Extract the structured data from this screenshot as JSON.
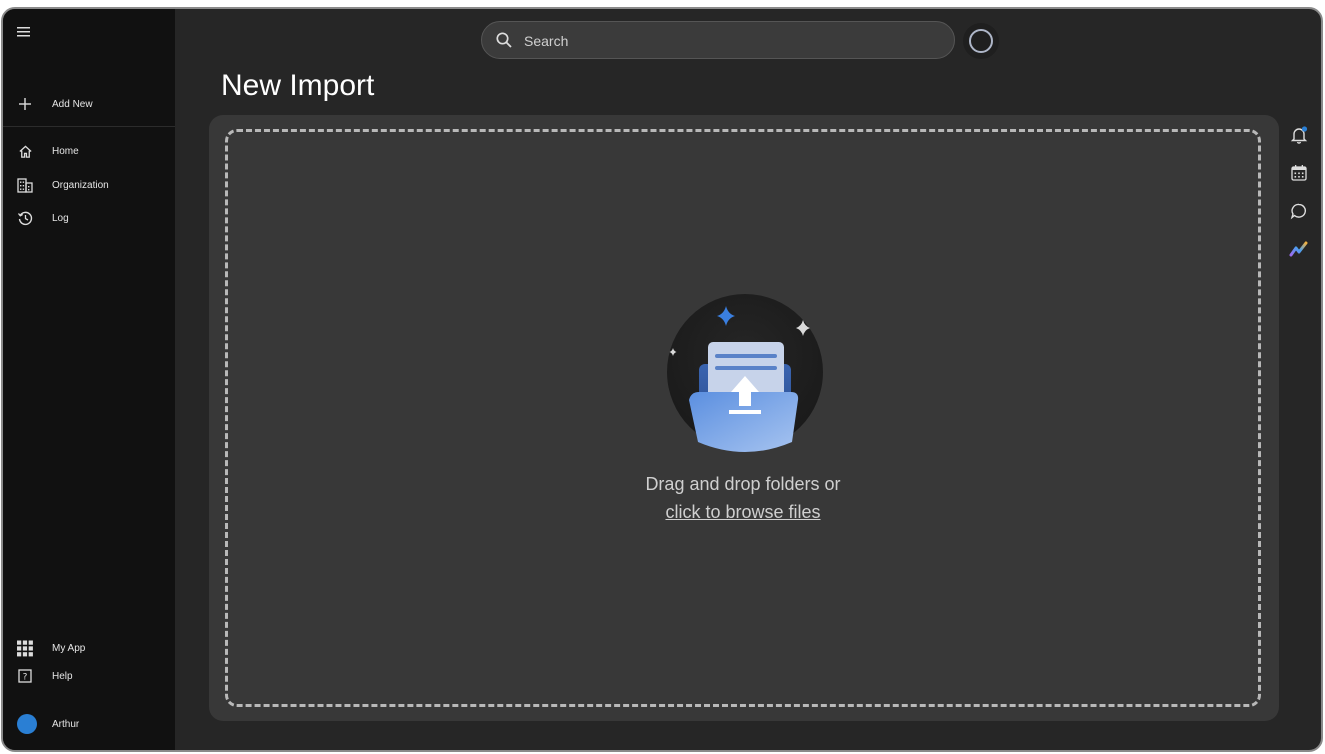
{
  "sidebar": {
    "top": [
      {
        "label": "Add New",
        "icon": "plus-icon"
      }
    ],
    "nav": [
      {
        "label": "Home",
        "icon": "home-icon"
      },
      {
        "label": "Organization",
        "icon": "building-icon"
      },
      {
        "label": "Log",
        "icon": "history-icon"
      }
    ],
    "bottom": [
      {
        "label": "My App",
        "icon": "apps-grid-icon"
      },
      {
        "label": "Help",
        "icon": "help-icon"
      }
    ],
    "user": {
      "name": "Arthur",
      "avatar_color": "#2a7fd4"
    }
  },
  "search": {
    "placeholder": "Search"
  },
  "page": {
    "title": "New Import"
  },
  "dropzone": {
    "line1": "Drag and drop folders or",
    "link": "click to browse files"
  },
  "right_rail": [
    "bell-icon",
    "calendar-icon",
    "chat-icon",
    "analytics-icon"
  ],
  "colors": {
    "accent": "#2a7fd4",
    "panel": "#383838",
    "background": "#262626",
    "sidebar": "#111111"
  }
}
